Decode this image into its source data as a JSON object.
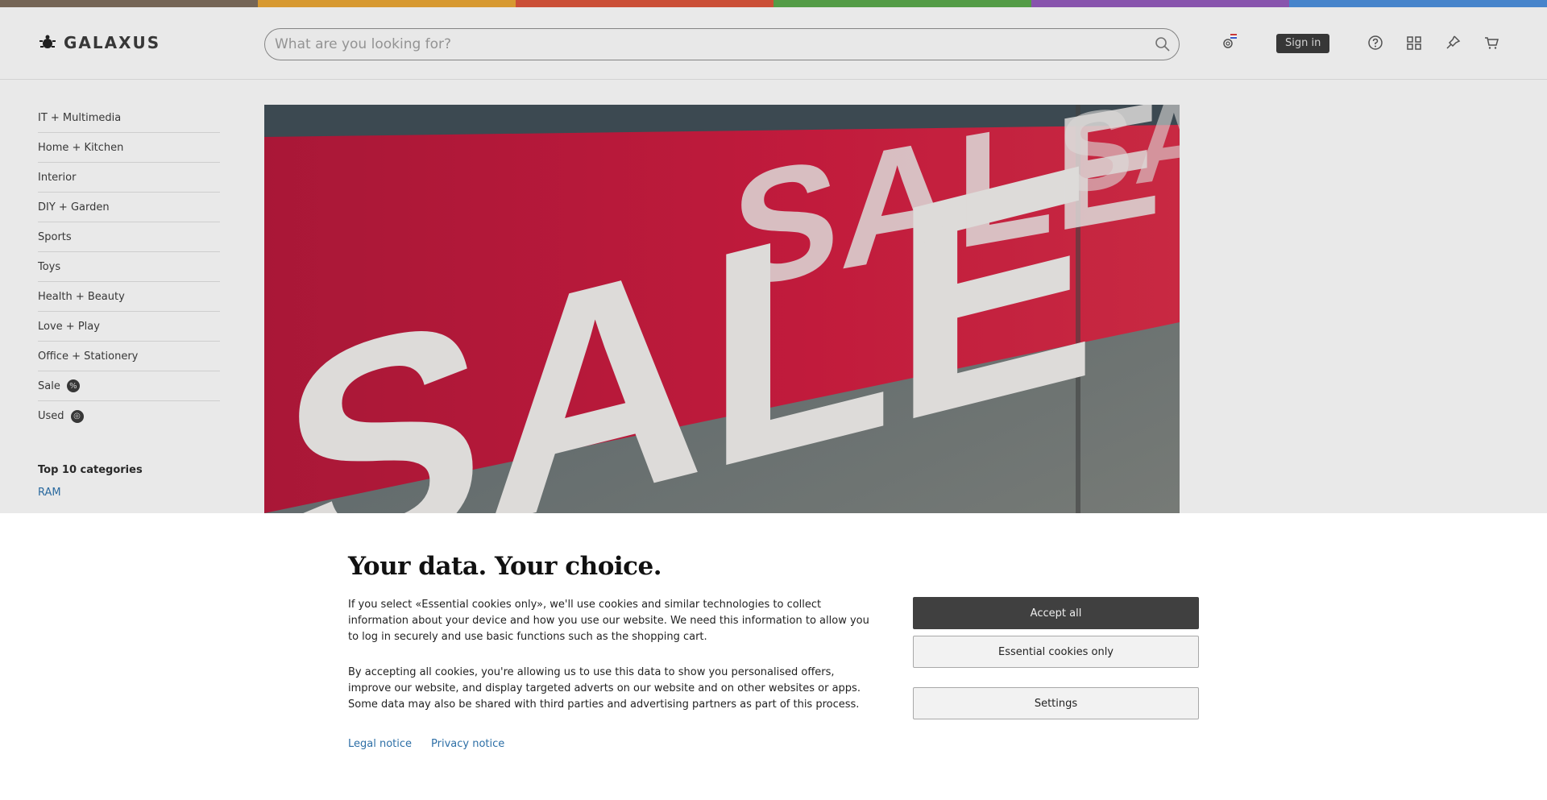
{
  "brand": {
    "name": "GALAXUS",
    "stripe_colors": [
      "#7a6a5a",
      "#e0a033",
      "#d4533a",
      "#58a34a",
      "#8e58b5",
      "#4a8ad4"
    ]
  },
  "search": {
    "placeholder": "What are you looking for?"
  },
  "header": {
    "sign_in": "Sign in"
  },
  "sidebar": {
    "items": [
      {
        "label": "IT + Multimedia"
      },
      {
        "label": "Home + Kitchen"
      },
      {
        "label": "Interior"
      },
      {
        "label": "DIY + Garden"
      },
      {
        "label": "Sports"
      },
      {
        "label": "Toys"
      },
      {
        "label": "Health + Beauty"
      },
      {
        "label": "Love + Play"
      },
      {
        "label": "Office + Stationery"
      },
      {
        "label": "Sale",
        "badge": "%"
      },
      {
        "label": "Used",
        "badge": "◎"
      }
    ],
    "top10_heading": "Top 10 categories",
    "top10_first": "RAM"
  },
  "hero": {
    "text": "SALE"
  },
  "cookie": {
    "title": "Your data. Your choice.",
    "paragraph1": "If you select «Essential cookies only», we'll use cookies and similar technologies to collect information about your device and how you use our website. We need this information to allow you to log in securely and use basic functions such as the shopping cart.",
    "paragraph2": "By accepting all cookies, you're allowing us to use this data to show you personalised offers, improve our website, and display targeted adverts on our website and on other websites or apps. Some data may also be shared with third parties and advertising partners as part of this process.",
    "legal_notice": "Legal notice",
    "privacy_notice": "Privacy notice",
    "accept_all": "Accept all",
    "essential_only": "Essential cookies only",
    "settings": "Settings"
  }
}
